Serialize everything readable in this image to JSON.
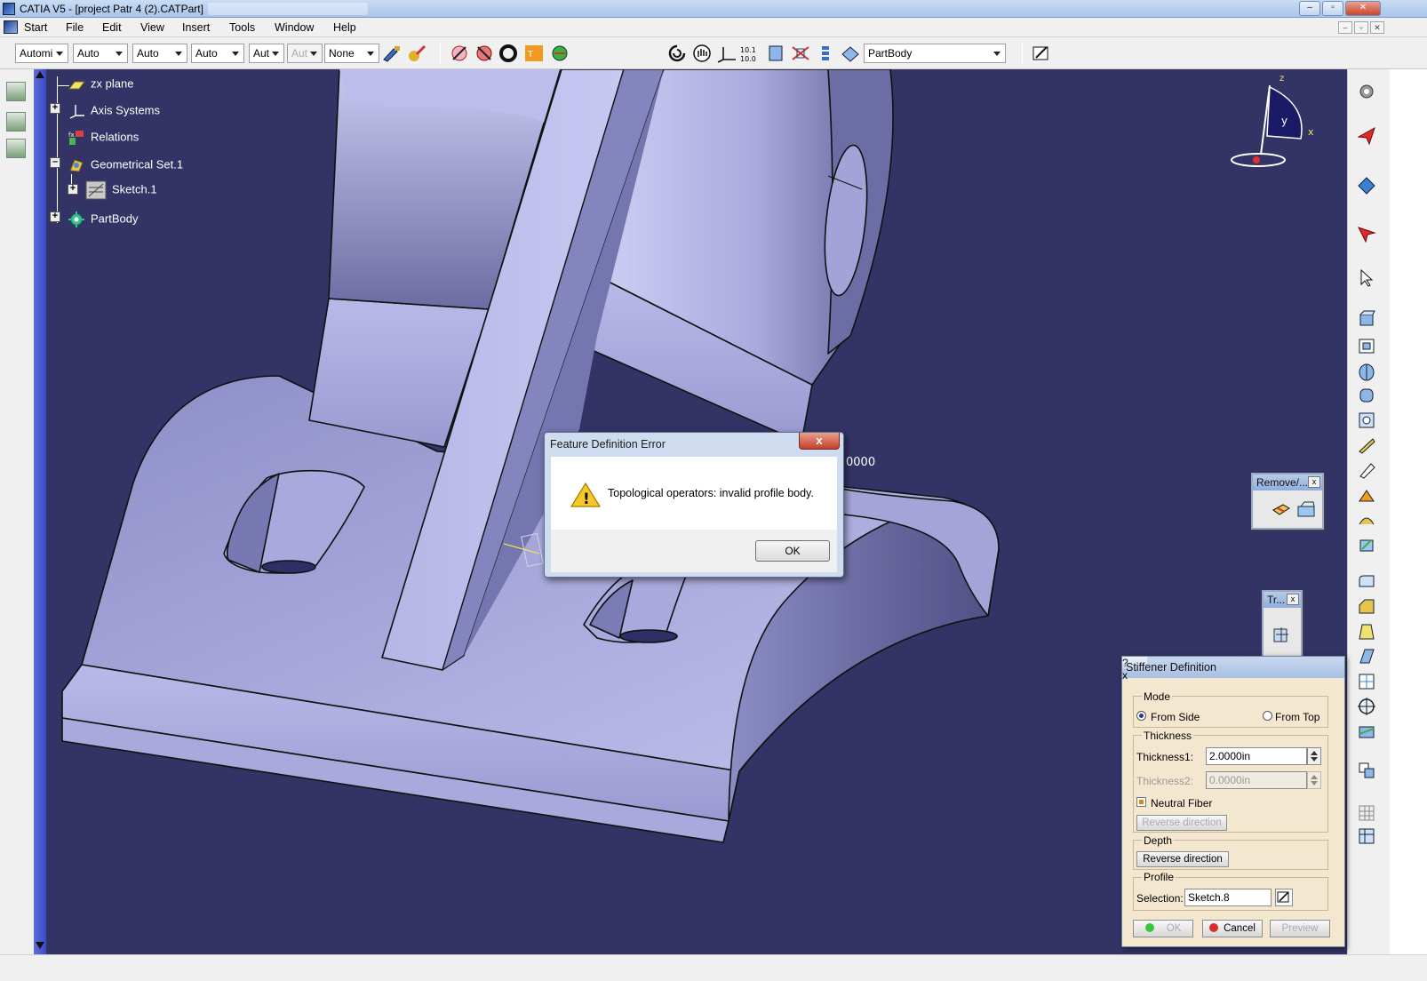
{
  "window": {
    "title": "CATIA V5 - [project Patr 4 (2).CATPart]",
    "min_label": "–",
    "max_label": "▫",
    "close_label": "✕",
    "doc_min_label": "–",
    "doc_max_label": "▫",
    "doc_close_label": "✕"
  },
  "menu": {
    "items": [
      {
        "label": "Start"
      },
      {
        "label": "File"
      },
      {
        "label": "Edit"
      },
      {
        "label": "View"
      },
      {
        "label": "Insert"
      },
      {
        "label": "Tools"
      },
      {
        "label": "Window"
      },
      {
        "label": "Help"
      }
    ]
  },
  "toolbar": {
    "combos": [
      {
        "value": "Automi"
      },
      {
        "value": "Auto"
      },
      {
        "value": "Auto"
      },
      {
        "value": "Auto"
      },
      {
        "value": "Aut"
      },
      {
        "value": "Aut"
      },
      {
        "value": "None"
      }
    ],
    "current_body": "PartBody"
  },
  "tree": {
    "nodes": [
      {
        "label": "zx plane"
      },
      {
        "label": "Axis Systems"
      },
      {
        "label": "Relations"
      },
      {
        "label": "Geometrical Set.1"
      },
      {
        "label": "Sketch.1"
      },
      {
        "label": "PartBody"
      }
    ],
    "expand_plus": "+",
    "expand_minus": "–"
  },
  "compass": {
    "x": "x",
    "y": "y",
    "z": "z"
  },
  "viewport": {
    "dimension_label": "0000"
  },
  "palettes": {
    "remove_title": "Remove/...",
    "transform_title": "Tr...",
    "close_label": "x"
  },
  "error_dialog": {
    "title": "Feature Definition Error",
    "message": "Topological operators: invalid profile body.",
    "ok_label": "OK",
    "close_label": "x",
    "warning_glyph": "!"
  },
  "stiffener": {
    "title": "Stiffener Definition",
    "help_label": "?",
    "close_label": "x",
    "mode_label": "Mode",
    "from_side_label": "From Side",
    "from_top_label": "From Top",
    "mode_selected": "From Side",
    "thickness_label": "Thickness",
    "thickness1_label": "Thickness1:",
    "thickness1_value": "2.0000in",
    "thickness2_label": "Thickness2:",
    "thickness2_value": "0.0000in",
    "neutral_fiber_label": "Neutral Fiber",
    "neutral_fiber_checked": true,
    "reverse_direction_thickness_label": "Reverse direction",
    "depth_label": "Depth",
    "reverse_direction_depth_label": "Reverse direction",
    "profile_label": "Profile",
    "selection_label": "Selection:",
    "selection_value": "Sketch.8",
    "ok_label": "OK",
    "cancel_label": "Cancel",
    "preview_label": "Preview"
  },
  "colors": {
    "background": "#333366",
    "part_face_light": "#c9c9ef",
    "part_face_mid": "#9e9ed4",
    "part_face_dark": "#6f6fa6",
    "tree_text": "#ffffff",
    "dialog_panel": "#f4e7cf"
  }
}
